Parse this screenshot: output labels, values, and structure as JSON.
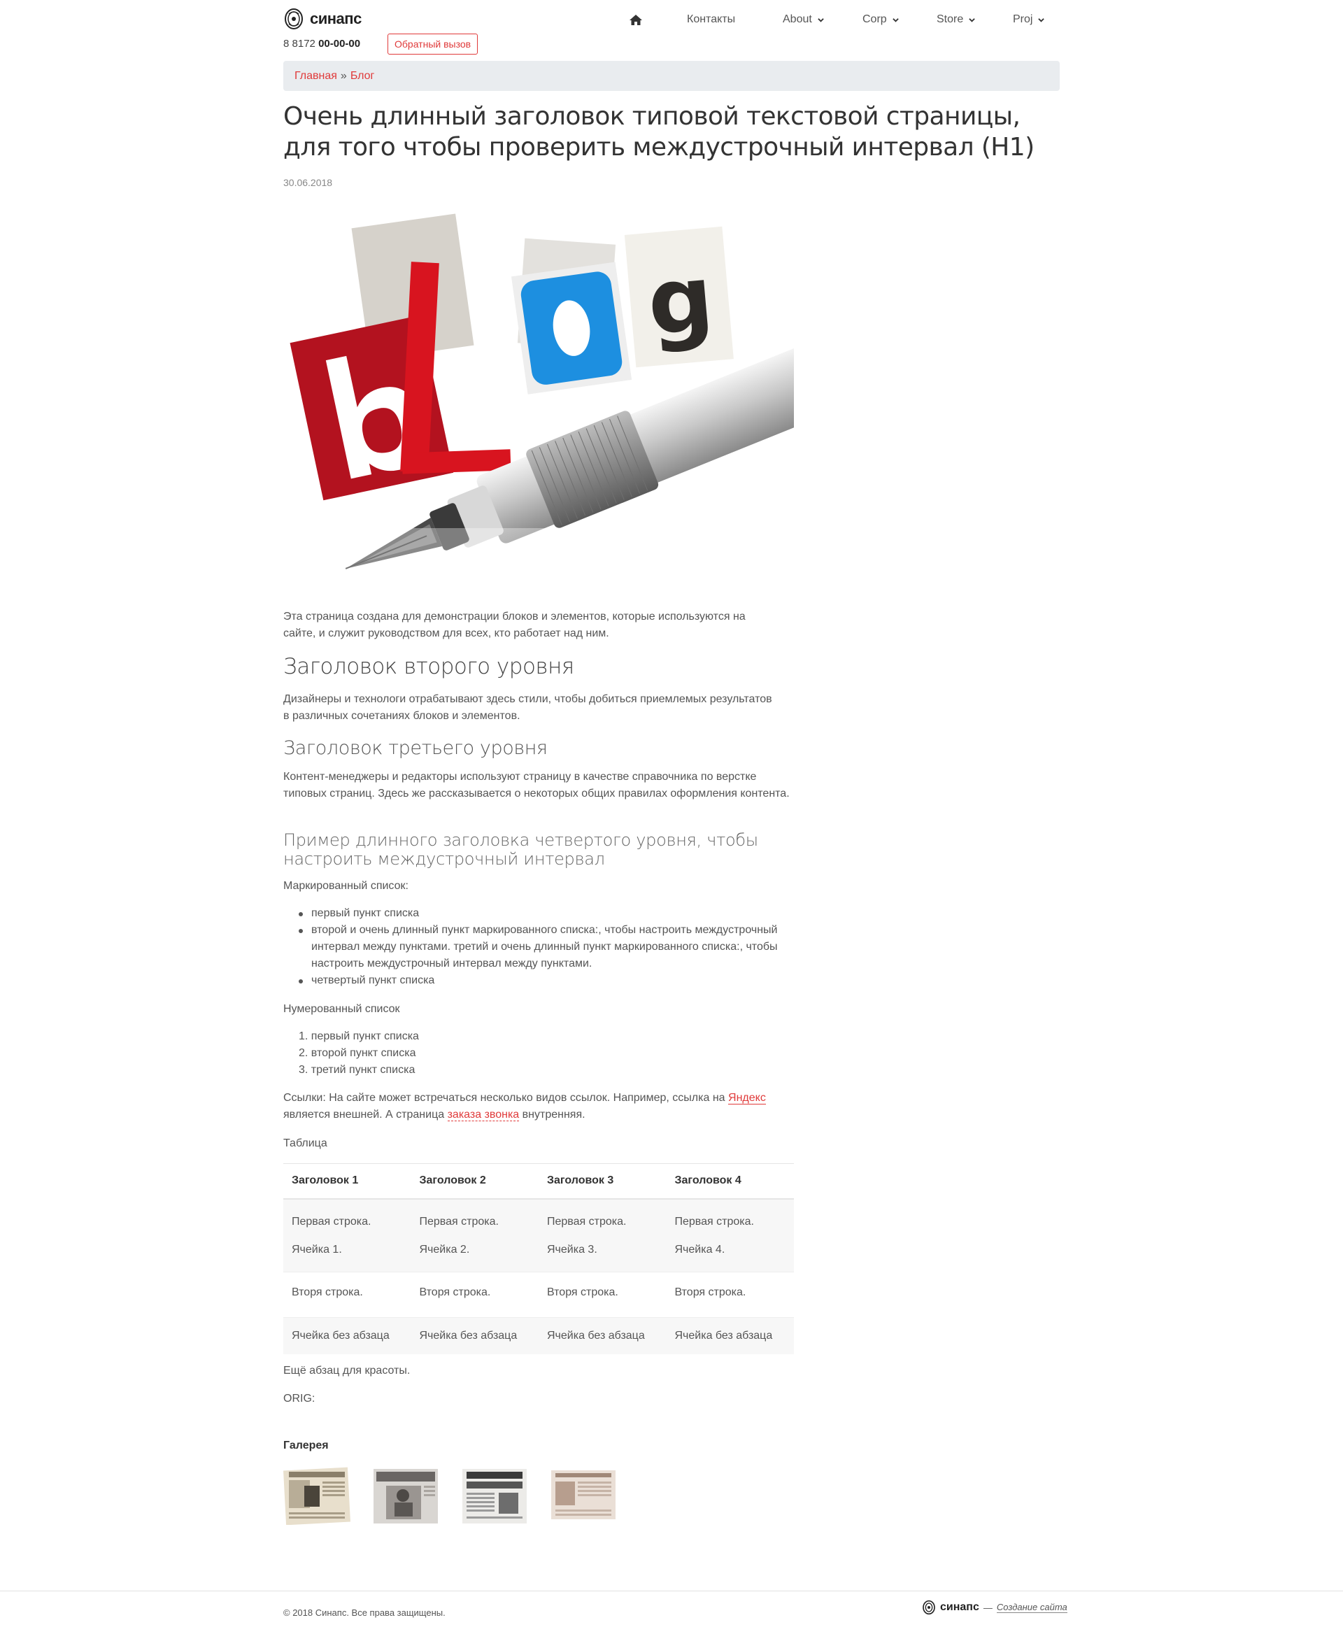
{
  "header": {
    "logo_text": "синапс",
    "phone_prefix": "8 8172",
    "phone_number": "00-00-00",
    "callback_label": "Обратный вызов"
  },
  "nav": {
    "home_icon": "home-icon",
    "contacts": "Контакты",
    "about": "About",
    "corp": "Corp",
    "store": "Store",
    "proj": "Proj"
  },
  "breadcrumb": {
    "home": "Главная",
    "separator": "»",
    "current": "Блог"
  },
  "article": {
    "title": "Очень длинный заголовок типовой текстовой страницы, для того чтобы проверить междустрочный интервал (H1)",
    "date": "30.06.2018",
    "hero_word": "blog",
    "intro": "Эта страница создана для демонстрации блоков и элементов, которые используются на сайте, и служит руководством для всех, кто работает над ним.",
    "h2": "Заголовок второго уровня",
    "p2": "Дизайнеры и технологи отрабатывают здесь стили, чтобы добиться приемлемых результатов в различных сочетаниях блоков и элементов.",
    "h3": "Заголовок третьего уровня",
    "p3": "Контент-менеджеры и редакторы используют страницу в качестве справочника по верстке типовых страниц. Здесь же рассказывается о некоторых общих правилах оформления контента.",
    "h4": "Пример длинного заголовка четвертого уровня, чтобы настроить междустрочный интервал",
    "bullet_intro": "Маркированный список:",
    "bullets": [
      "первый пункт списка",
      "второй и очень длинный пункт маркированного списка:, чтобы настроить междустрочный интервал между пунктами. третий и очень длинный пункт маркированного списка:, чтобы настроить междустрочный интервал между пунктами.",
      "четвертый пункт списка"
    ],
    "ordered_intro": "Нумерованный список",
    "ordered": [
      "1. первый пункт списка",
      "2. второй пункт списка",
      "3. третий пункт списка"
    ],
    "links_text_1": "Ссылки: На сайте может встречаться несколько видов ссылок. Например, ссылка на ",
    "links_ext": "Яндекс",
    "links_text_2": " является внешней. А страница ",
    "links_int": "заказа звонка",
    "links_text_3": " внутренняя.",
    "table_intro": "Таблица",
    "table": {
      "headers": [
        "Заголовок 1",
        "Заголовок 2",
        "Заголовок 3",
        "Заголовок 4"
      ],
      "row1": [
        [
          "Первая строка.",
          "Ячейка 1."
        ],
        [
          "Первая строка.",
          "Ячейка 2."
        ],
        [
          "Первая строка.",
          "Ячейка 3."
        ],
        [
          "Первая строка.",
          "Ячейка 4."
        ]
      ],
      "row2": [
        "Вторя строка.",
        "Вторя строка.",
        "Вторя строка.",
        "Вторя строка."
      ],
      "row3": [
        "Ячейка без абзаца",
        "Ячейка без абзаца",
        "Ячейка без абзаца",
        "Ячейка без абзаца"
      ]
    },
    "extra": "Ещё абзац для красоты.",
    "orig": "ORIG:"
  },
  "gallery": {
    "title": "Галерея"
  },
  "footer": {
    "copyright": "© 2018 Синапс. Все права защищены.",
    "brand": "синапс",
    "dash": "—",
    "link": "Создание сайта"
  },
  "colors": {
    "accent": "#e03a3a",
    "breadcrumb_bg": "#e9ecef"
  }
}
